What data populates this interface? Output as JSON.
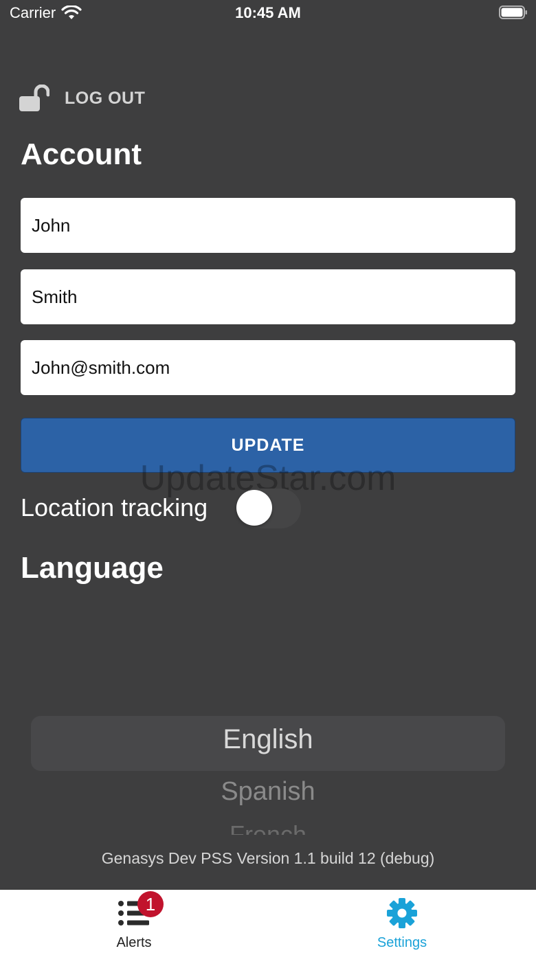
{
  "status_bar": {
    "carrier": "Carrier",
    "time": "10:45 AM",
    "icons": [
      "wifi-icon",
      "battery-icon"
    ]
  },
  "logout": {
    "label": "LOG OUT",
    "icon": "unlocked-padlock-icon"
  },
  "account": {
    "title": "Account",
    "first_name": "John",
    "last_name": "Smith",
    "email": "John@smith.com",
    "update_label": "UPDATE"
  },
  "watermark": "UpdateStar.com",
  "location": {
    "label": "Location tracking",
    "enabled": false
  },
  "language": {
    "title": "Language",
    "options": [
      "English",
      "Spanish",
      "French"
    ],
    "selected": "English"
  },
  "version": "Genasys Dev PSS Version 1.1 build 12 (debug)",
  "tabs": [
    {
      "label": "Alerts",
      "icon": "list-icon",
      "badge": "1",
      "active": false
    },
    {
      "label": "Settings",
      "icon": "gear-icon",
      "active": true
    }
  ],
  "colors": {
    "background": "#3e3e3f",
    "button": "#2c62a6",
    "active_tab": "#1aa2d8",
    "badge": "#c1132d"
  }
}
